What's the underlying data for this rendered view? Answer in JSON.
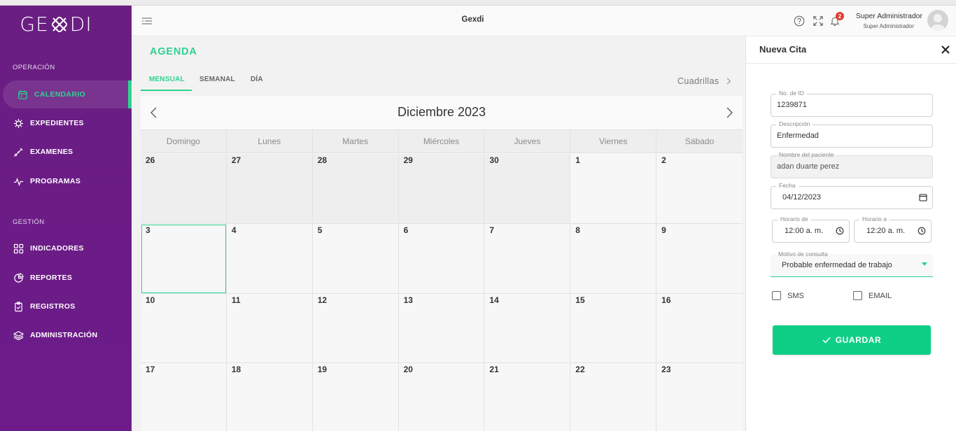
{
  "brand": {
    "logo_left": "GE",
    "logo_right": "DI"
  },
  "header": {
    "title": "Gexdi",
    "notification_count": "2",
    "user_name": "Super Administrador",
    "user_role": "Super Administrador"
  },
  "sidebar": {
    "section_operation": "OPERACIÓN",
    "section_management": "GESTIÓN",
    "items": [
      {
        "label": "CALENDARIO",
        "icon": "calendar-icon"
      },
      {
        "label": "EXPEDIENTES",
        "icon": "virus-icon"
      },
      {
        "label": "EXAMENES",
        "icon": "syringe-icon"
      },
      {
        "label": "PROGRAMAS",
        "icon": "pulse-icon"
      },
      {
        "label": "INDICADORES",
        "icon": "grid-icon"
      },
      {
        "label": "REPORTES",
        "icon": "pie-chart-icon"
      },
      {
        "label": "REGISTROS",
        "icon": "clipboard-check-icon"
      },
      {
        "label": "ADMINISTRACIÓN",
        "icon": "layers-icon"
      }
    ]
  },
  "main": {
    "title": "AGENDA",
    "tabs": [
      "MENSUAL",
      "SEMANAL",
      "DÍA"
    ],
    "cuadrillas_label": "Cuadrillas",
    "calendar": {
      "month": "Diciembre",
      "year": "2023",
      "weekdays": [
        "Domingo",
        "Lunes",
        "Martes",
        "Miércoles",
        "Jueves",
        "Viernes",
        "Sábado"
      ],
      "days": [
        "26",
        "27",
        "28",
        "29",
        "30",
        "1",
        "2",
        "3",
        "4",
        "5",
        "6",
        "7",
        "8",
        "9",
        "10",
        "11",
        "12",
        "13",
        "14",
        "15",
        "16",
        "17",
        "18",
        "19",
        "20",
        "21",
        "22",
        "23"
      ]
    }
  },
  "panel": {
    "title": "Nueva Cita",
    "id_label": "No. de ID",
    "id_value": "1239871",
    "desc_label": "Descripción",
    "desc_value": "Enfermedad",
    "patient_label": "Nombre del paciente",
    "patient_value": "adan duarte perez",
    "date_label": "Fecha",
    "date_value": "04/12/2023",
    "time_from_label": "Horario de",
    "time_from_value": "12:00 a. m.",
    "time_to_label": "Horario a",
    "time_to_value": "12:20 a. m.",
    "reason_label": "Motivo de consulta",
    "reason_value": "Probable enfermedad de trabajo",
    "sms_label": "SMS",
    "email_label": "EMAIL",
    "save_label": "GUARDAR"
  },
  "colors": {
    "sidebar": "#6b1c86",
    "accent": "#2ed28f",
    "button": "#0fcf86",
    "badge": "#e23b2e"
  }
}
